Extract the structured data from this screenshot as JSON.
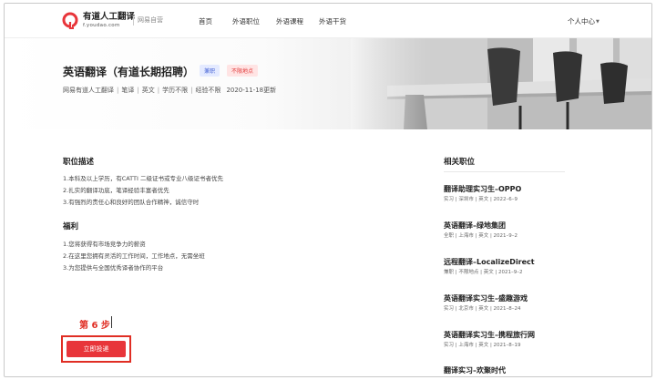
{
  "header": {
    "brand_name": "有道人工翻译",
    "brand_url": "f.youdao.com",
    "brand_tag": "网易自营",
    "nav": [
      "首页",
      "外语职位",
      "外语课程",
      "外语干货"
    ],
    "user_menu": "个人中心"
  },
  "job": {
    "title": "英语翻译（有道长期招聘）",
    "badges": [
      "兼职",
      "不限地点"
    ],
    "meta": [
      "网易有道人工翻译",
      "笔译",
      "英文",
      "学历不限",
      "经验不限"
    ],
    "updated": "2020-11-18更新"
  },
  "description": {
    "title": "职位描述",
    "lines": [
      "1.本科及以上学历，有CATTI 二级证书或专业八级证书者优先",
      "2.扎实的翻译功底，笔译经验丰富者优先",
      "3.有强烈的责任心和良好的团队合作精神，诚信守时"
    ]
  },
  "benefits": {
    "title": "福利",
    "lines": [
      "1.您将获得有市场竞争力的薪资",
      "2.在这里您拥有灵活的工作时间，工作地点，无需坐班",
      "3.为您提供与全国优秀译者协作的平台"
    ]
  },
  "annotation": {
    "step": "第 6 步"
  },
  "apply_button": "立即投递",
  "sidebar": {
    "title": "相关职位",
    "jobs": [
      {
        "title": "翻译助理实习生–OPPO",
        "meta": "实习 | 深圳市 | 英文 | 2022–6–9"
      },
      {
        "title": "英语翻译–绿地集团",
        "meta": "全职 | 上海市 | 英文 | 2021–9–2"
      },
      {
        "title": "远程翻译–LocalizeDirect",
        "meta": "兼职 | 不限地点 | 英文 | 2021–9–2"
      },
      {
        "title": "英语翻译实习生–盛趣游戏",
        "meta": "实习 | 北京市 | 英文 | 2021–8–24"
      },
      {
        "title": "英语翻译实习生–携程旅行网",
        "meta": "实习 | 上海市 | 英文 | 2021–8–19"
      },
      {
        "title": "翻译实习–欢聚时代",
        "meta": ""
      }
    ]
  },
  "colors": {
    "accent": "#e8353a",
    "annotation": "#e02e24",
    "badge_blue": "#4a66d6",
    "badge_red": "#e23b3b"
  }
}
